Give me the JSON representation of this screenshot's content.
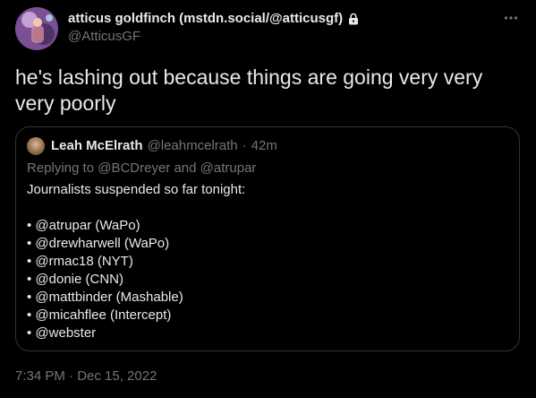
{
  "tweet": {
    "author": {
      "display_name": "atticus goldfinch (mstdn.social/@atticusgf)",
      "handle": "@AtticusGF",
      "protected_icon": "lock-icon"
    },
    "text": "he's lashing out because things are going very very very poorly",
    "timestamp": "7:34 PM · Dec 15, 2022",
    "more_icon": "more-horizontal-icon"
  },
  "quoted": {
    "author": {
      "display_name": "Leah McElrath",
      "handle": "@leahmcelrath",
      "separator": "·",
      "time": "42m"
    },
    "reply": {
      "prefix": "Replying to",
      "user1": "@BCDreyer",
      "conjunction": "and",
      "user2": "@atrupar"
    },
    "intro": "Journalists suspended so far tonight:",
    "items": [
      "• @atrupar (WaPo)",
      "• @drewharwell (WaPo)",
      "• @rmac18 (NYT)",
      "• @donie (CNN)",
      "• @mattbinder (Mashable)",
      "• @micahflee (Intercept)",
      "• @webster"
    ]
  },
  "colors": {
    "background": "#000000",
    "text_primary": "#e7e9ea",
    "text_secondary": "#71767b",
    "border": "#2f3336"
  }
}
